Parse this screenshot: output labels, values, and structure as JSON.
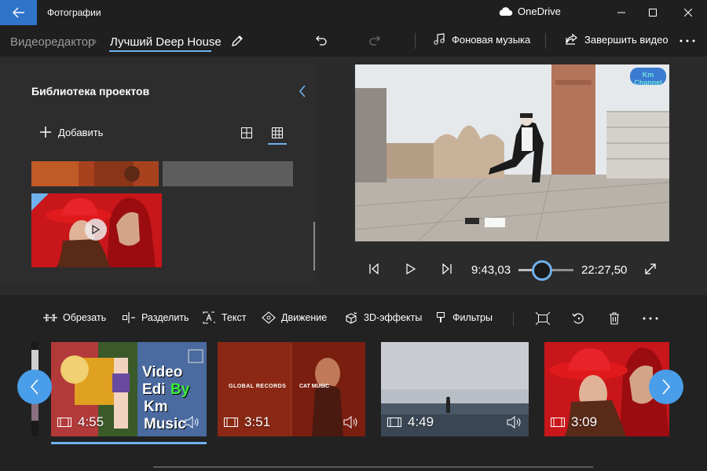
{
  "window": {
    "title": "Фотографии",
    "onedrive_label": "OneDrive"
  },
  "breadcrumb": {
    "root": "Видеоредактор",
    "separator": "›",
    "current": "Лучший Deep House"
  },
  "commands": {
    "background_music": "Фоновая музыка",
    "finish_video": "Завершить видео"
  },
  "library": {
    "title": "Библиотека проектов",
    "add_label": "Добавить"
  },
  "preview": {
    "watermark": "Km Channel"
  },
  "playback": {
    "current_time": "9:43,03",
    "total_time": "22:27,50",
    "progress": 0.43
  },
  "storyboard": {
    "tools": {
      "trim": "Обрезать",
      "split": "Разделить",
      "text": "Текст",
      "motion": "Движение",
      "effects3d": "3D-эффекты",
      "filters": "Фильтры"
    },
    "clips": [
      {
        "duration": "4:55",
        "overlay_line1": "Video Edi",
        "overlay_line2": "By",
        "overlay_line3": "Km Music"
      },
      {
        "duration": "3:51",
        "overlay_left": "GLOBAL RECORDS",
        "overlay_right": "CAT MUSIC"
      },
      {
        "duration": "4:49"
      },
      {
        "duration": "3:09"
      }
    ]
  },
  "colors": {
    "accent": "#6fb1ee",
    "back_button": "#2f74c9",
    "nav_button": "#4a9de8"
  }
}
